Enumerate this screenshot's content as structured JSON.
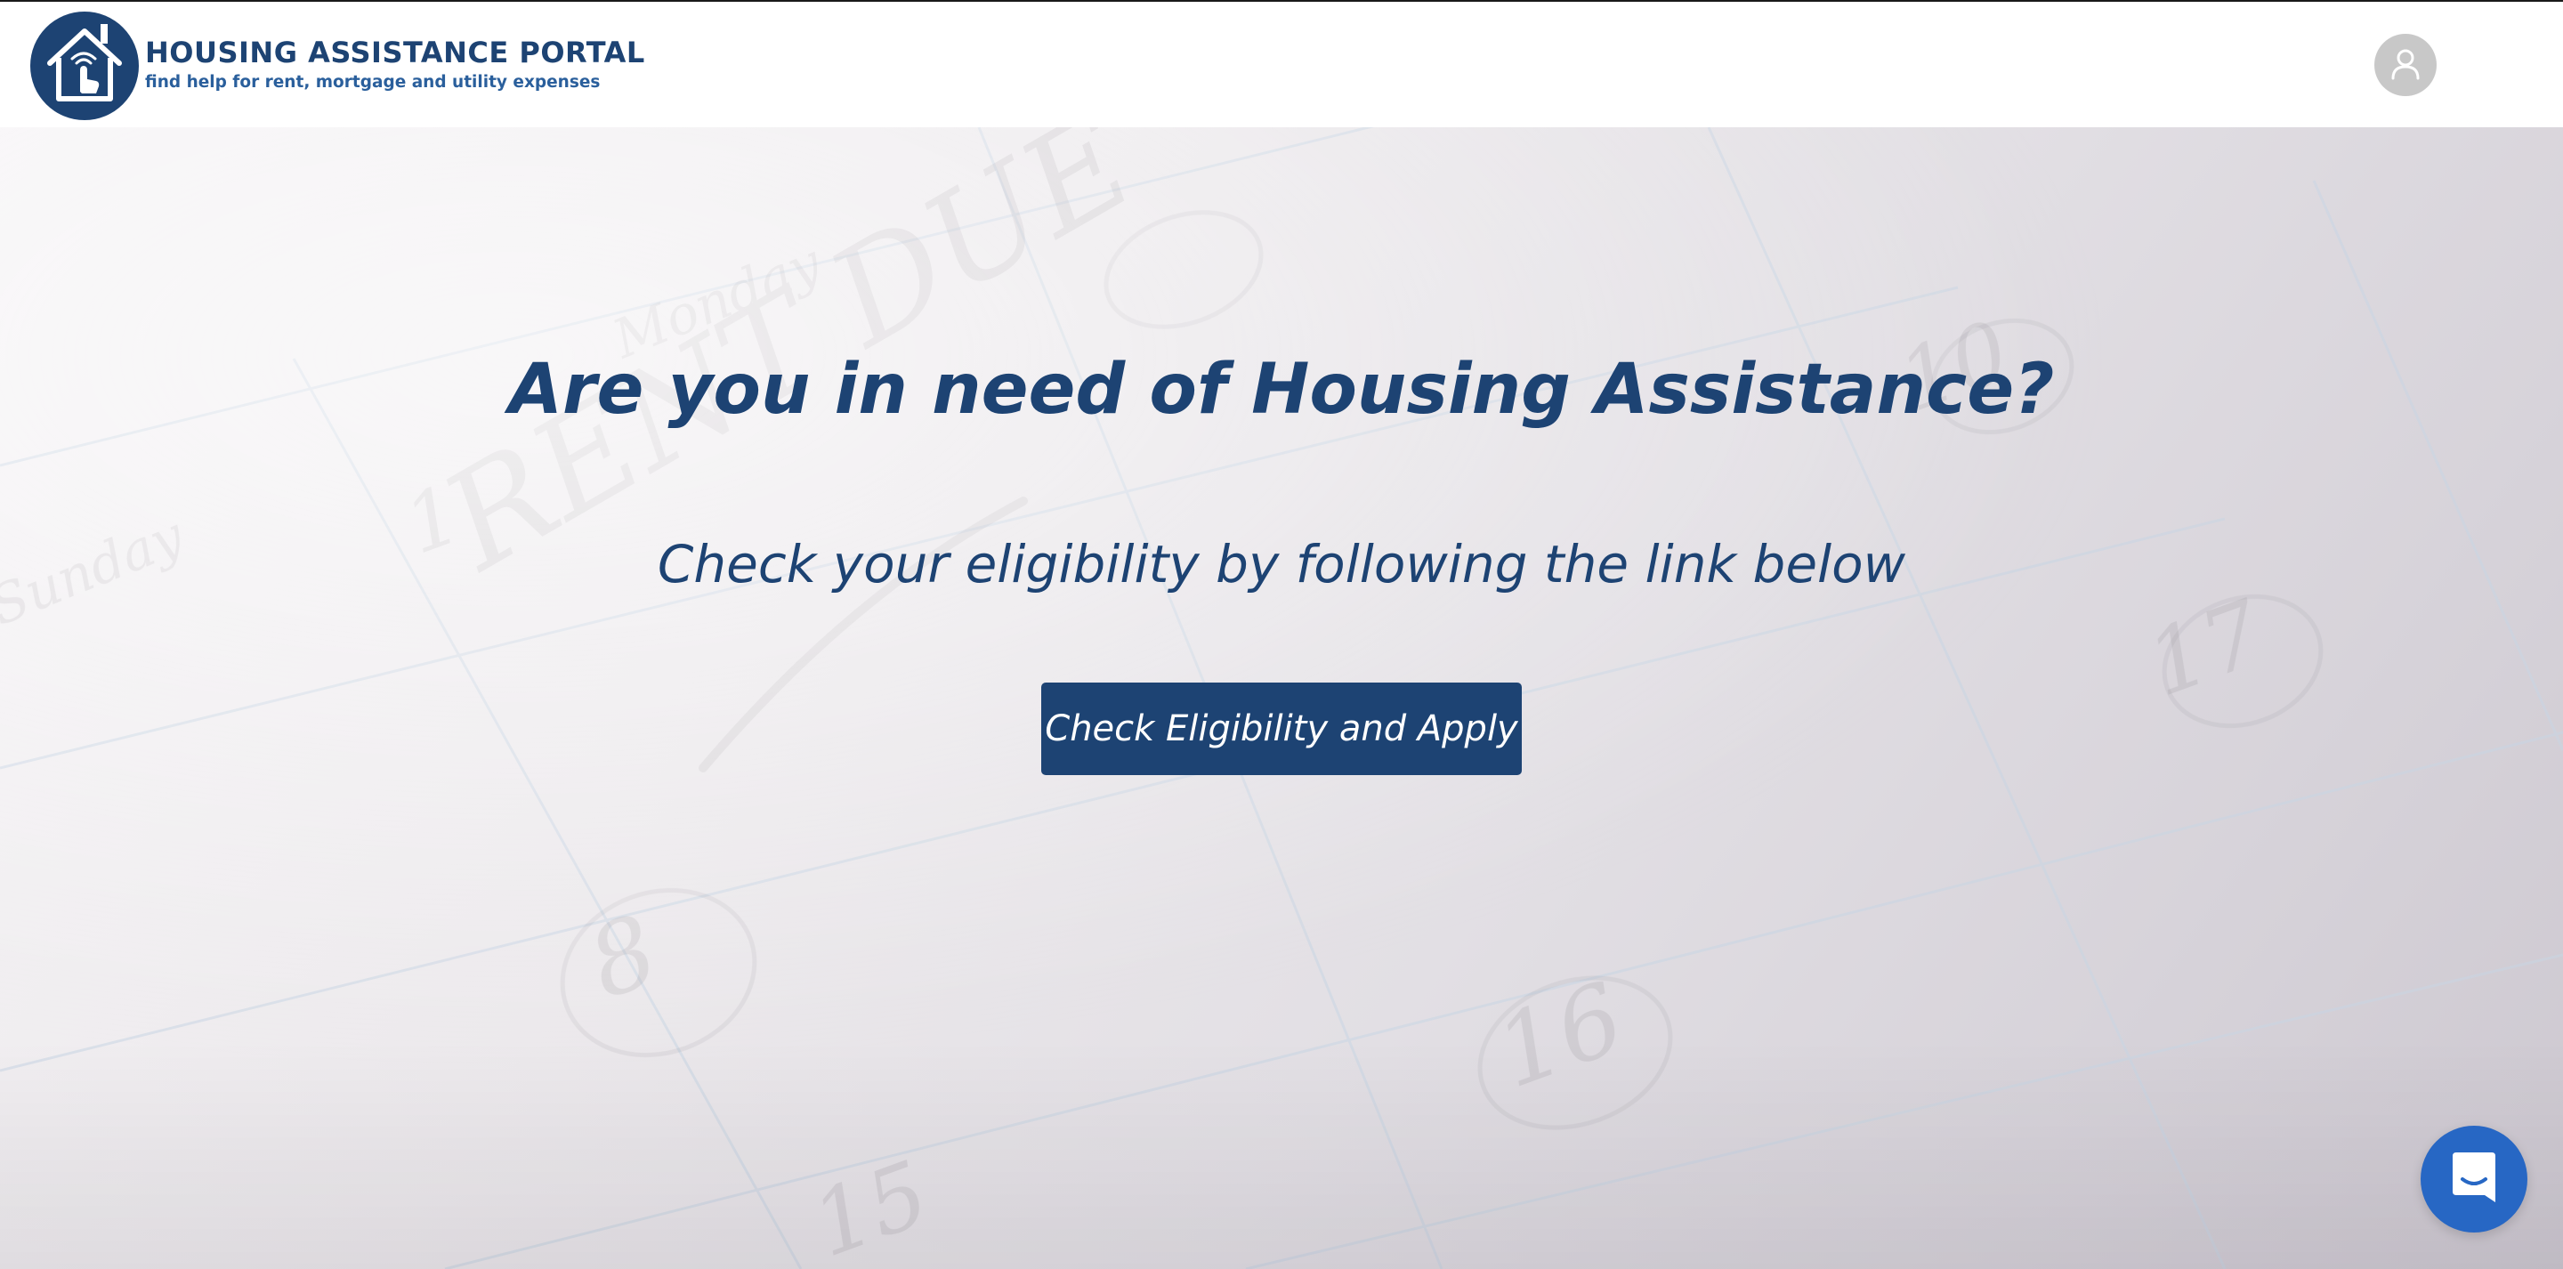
{
  "header": {
    "logo_icon": "house-hand-icon",
    "brand_title": "HOUSING ASSISTANCE PORTAL",
    "brand_tagline": "find help for rent, mortgage and utility expenses",
    "account_icon": "user-icon"
  },
  "hero": {
    "background_image": "calendar-rent-due-photo",
    "headline": "Are you in need of Housing Assistance?",
    "subheadline": "Check your eligibility by following the link below",
    "cta_label": "Check Eligibility and Apply"
  },
  "chat": {
    "icon": "chat-bubble-icon"
  },
  "colors": {
    "brand_navy": "#1d4373",
    "tagline_blue": "#2a5f9c",
    "chat_blue": "#2767c4",
    "avatar_gray": "#c8c8c8"
  }
}
